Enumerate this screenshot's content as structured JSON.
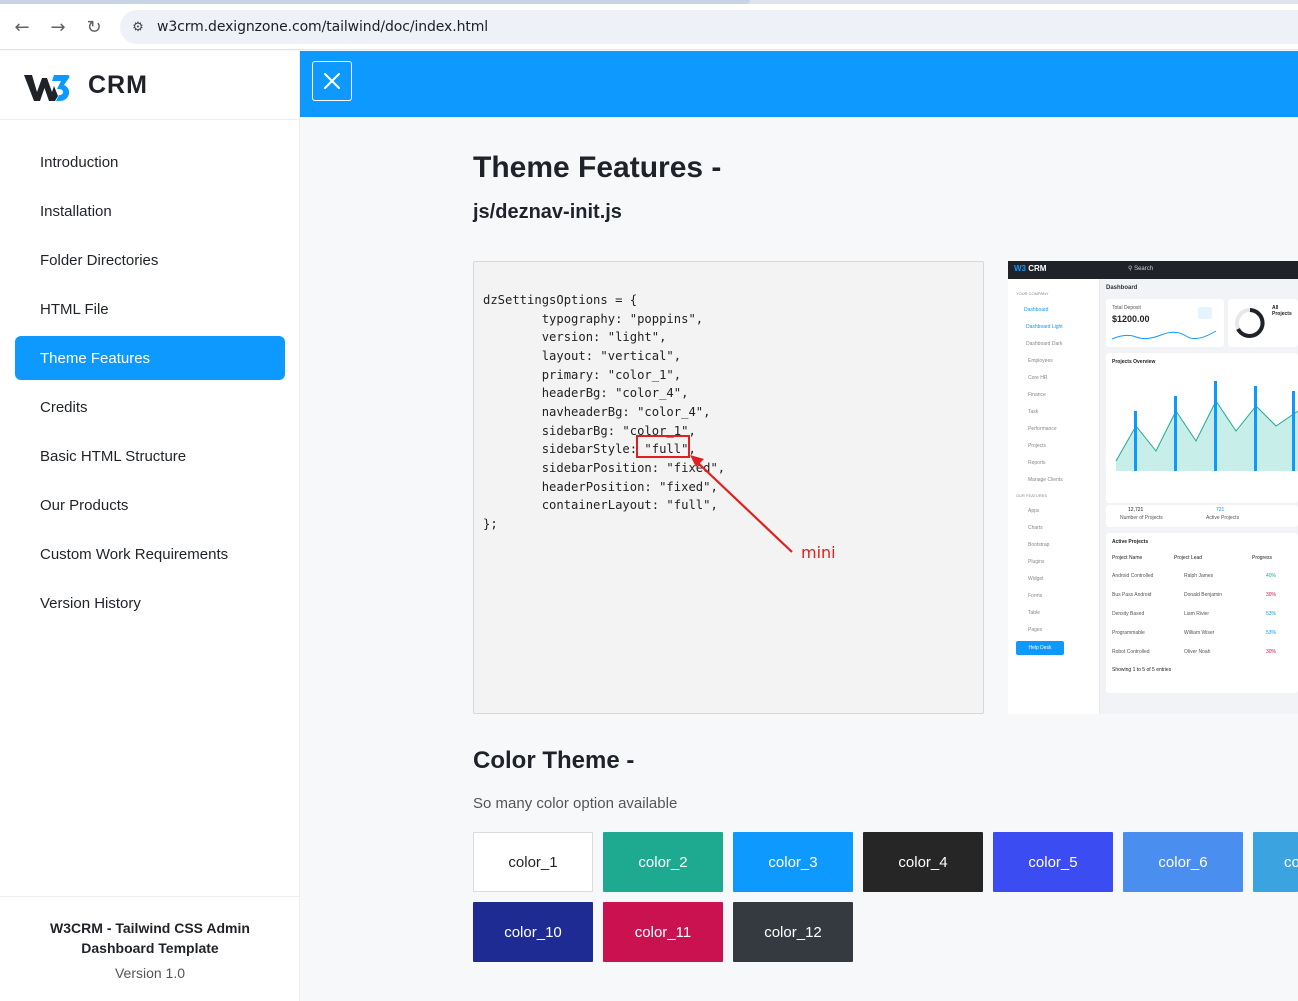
{
  "browser": {
    "url": "w3crm.dexignzone.com/tailwind/doc/index.html",
    "back_icon": "arrow-left-icon",
    "forward_icon": "arrow-right-icon",
    "reload_icon": "reload-icon",
    "site_icon": "tune-icon"
  },
  "sidebar": {
    "logo_text": "CRM",
    "items": [
      {
        "label": "Introduction",
        "active": false
      },
      {
        "label": "Installation",
        "active": false
      },
      {
        "label": "Folder Directories",
        "active": false
      },
      {
        "label": "HTML File",
        "active": false
      },
      {
        "label": "Theme Features",
        "active": true
      },
      {
        "label": "Credits",
        "active": false
      },
      {
        "label": "Basic HTML Structure",
        "active": false
      },
      {
        "label": "Our Products",
        "active": false
      },
      {
        "label": "Custom Work Requirements",
        "active": false
      },
      {
        "label": "Version History",
        "active": false
      }
    ],
    "footer_title": "W3CRM - Tailwind CSS Admin Dashboard Template",
    "footer_version": "Version 1.0"
  },
  "header": {
    "close_icon": "close-icon",
    "accent": "#0d99ff"
  },
  "theme_features": {
    "title": "Theme Features -",
    "file": "js/deznav-init.js",
    "code": "dzSettingsOptions = {\n        typography: \"poppins\",\n        version: \"light\",\n        layout: \"vertical\",\n        primary: \"color_1\",\n        headerBg: \"color_4\",\n        navheaderBg: \"color_4\",\n        sidebarBg: \"color_1\",\n        sidebarStyle: \"full\",\n        sidebarPosition: \"fixed\",\n        headerPosition: \"fixed\",\n        containerLayout: \"full\",\n};",
    "annotation": "mini",
    "annotation_color": "#e0201e"
  },
  "preview": {
    "logo": "CRM",
    "search": "Search",
    "breadcrumb": "Dashboard",
    "company": "YOUR COMPANY",
    "side_items": [
      "Dashboard",
      "Dashboard Light",
      "Dashboard Dark",
      "Employees",
      "Core HR",
      "Finance",
      "Task",
      "Performance",
      "Projects",
      "Reports",
      "Manage Clients",
      "OUR FEATURES",
      "Apps",
      "Charts",
      "Bootstrap",
      "Plugins",
      "Widget",
      "Forms",
      "Table",
      "Pages"
    ],
    "help": "Help Desk",
    "deposit_label": "Total Deposit",
    "deposit_value": "$1200.00",
    "projects_label": "All Projects",
    "overview": "Projects Overview",
    "stat1_value": "12,721",
    "stat1_label": "Number of Projects",
    "stat2_value": "721",
    "stat2_label": "Active Projects",
    "active_projects": "Active Projects",
    "col_name": "Project Name",
    "col_lead": "Project Lead",
    "col_progress": "Progress",
    "rows": [
      {
        "name": "Android Controlled",
        "lead": "Ralph James",
        "pct": "40%"
      },
      {
        "name": "Bus Pass Android",
        "lead": "Donald Benjamin",
        "pct": "30%"
      },
      {
        "name": "Density Based",
        "lead": "Liam Rivier",
        "pct": "53%"
      },
      {
        "name": "Programmable",
        "lead": "William Wiser",
        "pct": "53%"
      },
      {
        "name": "Robot Controlled",
        "lead": "Oliver Noah",
        "pct": "30%"
      }
    ],
    "showing": "Showing 1 to 5 of 5 entries"
  },
  "color_theme": {
    "title": "Color Theme -",
    "description": "So many color option available",
    "swatches": [
      {
        "label": "color_1",
        "color": "#ffffff",
        "text": "#1f2329"
      },
      {
        "label": "color_2",
        "color": "#1eaa91",
        "text": "#ffffff"
      },
      {
        "label": "color_3",
        "color": "#0d99ff",
        "text": "#ffffff"
      },
      {
        "label": "color_4",
        "color": "#262626",
        "text": "#ffffff"
      },
      {
        "label": "color_5",
        "color": "#3a4cf2",
        "text": "#ffffff"
      },
      {
        "label": "color_6",
        "color": "#4a8ef0",
        "text": "#ffffff"
      },
      {
        "label": "co",
        "color": "#3aa3e0",
        "text": "#ffffff"
      },
      {
        "label": "color_10",
        "color": "#1d2b92",
        "text": "#ffffff"
      },
      {
        "label": "color_11",
        "color": "#c9124f",
        "text": "#ffffff"
      },
      {
        "label": "color_12",
        "color": "#343a40",
        "text": "#ffffff"
      }
    ]
  }
}
